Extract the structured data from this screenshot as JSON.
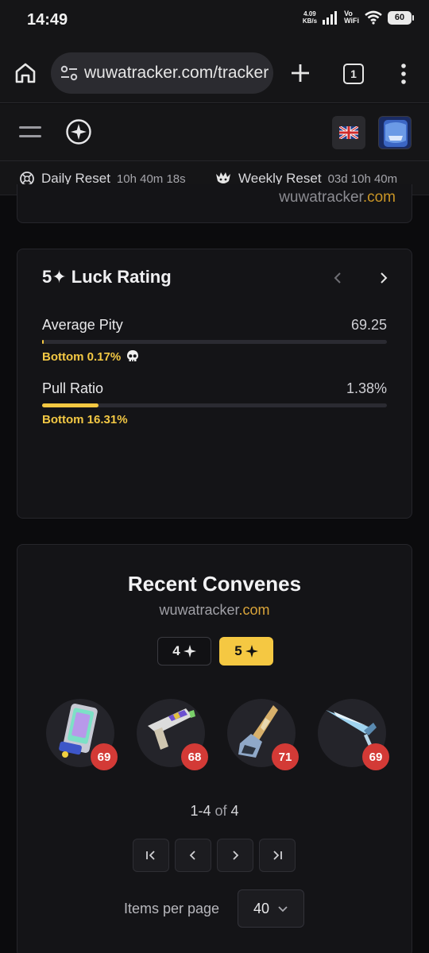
{
  "status": {
    "time": "14:49",
    "net_speed_value": "4.09",
    "net_speed_unit": "KB/s",
    "vo_label": "Vo",
    "wifi_label": "WiFi",
    "battery": "60"
  },
  "browser": {
    "url": "wuwatracker.com/tracker",
    "tab_count": "1"
  },
  "reset": {
    "daily_label": "Daily Reset",
    "daily_time": "10h 40m 18s",
    "weekly_label": "Weekly Reset",
    "weekly_time": "03d 10h 40m"
  },
  "partial_card": {
    "brand_main": "wuwatracker",
    "brand_tld": ".com"
  },
  "luck": {
    "title": "5✦ Luck Rating",
    "average_pity_label": "Average Pity",
    "average_pity_value": "69.25",
    "average_pity_fill": 0.0017,
    "average_pity_rank": "Bottom 0.17%",
    "pull_ratio_label": "Pull Ratio",
    "pull_ratio_value": "1.38%",
    "pull_ratio_fill": 0.1631,
    "pull_ratio_rank": "Bottom 16.31%",
    "accent_color": "#f5c842"
  },
  "recent": {
    "title": "Recent Convenes",
    "brand_main": "wuwatracker",
    "brand_tld": ".com",
    "filter_4": "4",
    "filter_5": "5",
    "pulls": [
      {
        "pity": "69",
        "icon": "rectifier-weapon-icon"
      },
      {
        "pity": "68",
        "icon": "pistol-weapon-icon"
      },
      {
        "pity": "71",
        "icon": "gauntlet-weapon-icon"
      },
      {
        "pity": "69",
        "icon": "sword-weapon-icon"
      }
    ],
    "range": "1-4",
    "of_word": "of",
    "total": "4",
    "items_per_page_label": "Items per page",
    "items_per_page_value": "40"
  }
}
